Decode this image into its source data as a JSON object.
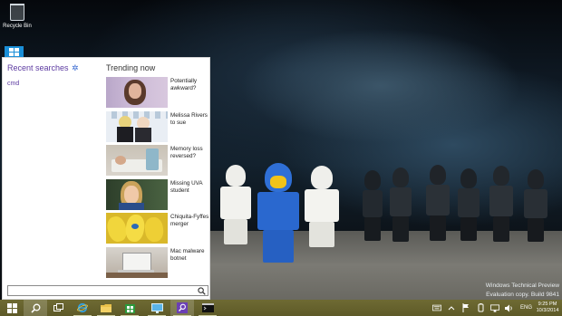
{
  "desktop": {
    "recycle_bin_label": "Recycle Bin"
  },
  "search_panel": {
    "recent_title": "Recent searches",
    "recent_items": [
      "cmd"
    ],
    "trending_title": "Trending now",
    "trending": [
      {
        "text": "Potentially awkward?",
        "img": "woman-portrait"
      },
      {
        "text": "Melissa Rivers to sue",
        "img": "two-women-event"
      },
      {
        "text": "Memory loss reversed?",
        "img": "hospital-bed"
      },
      {
        "text": "Missing UVA student",
        "img": "young-woman"
      },
      {
        "text": "Chiquita-Fyffes merger",
        "img": "bananas"
      },
      {
        "text": "Mac malware botnet",
        "img": "laptop-desk"
      }
    ],
    "search_input_value": ""
  },
  "watermark": {
    "line1": "Windows Technical Preview",
    "line2": "Evaluation copy. Build 9841"
  },
  "taskbar": {
    "language": "ENG",
    "time": "9:25 PM",
    "date": "10/3/2014",
    "accent": "#6a6630"
  }
}
